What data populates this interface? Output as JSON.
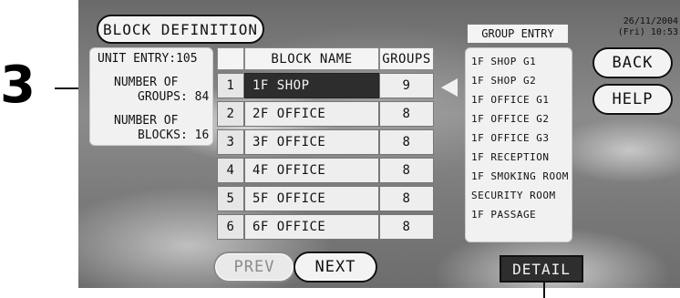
{
  "callout": {
    "label": "3"
  },
  "window": {
    "title": "BLOCK DEFINITION",
    "date": "26/11/2004",
    "day_time": "(Fri) 10:53"
  },
  "info": {
    "unit_entry": "UNIT ENTRY:105",
    "groups_line1": "NUMBER OF",
    "groups_line2": "GROUPS: 84",
    "blocks_line1": "NUMBER OF",
    "blocks_line2": "BLOCKS: 16"
  },
  "table": {
    "headers": {
      "num": "",
      "name": "BLOCK NAME",
      "groups": "GROUPS"
    },
    "rows": [
      {
        "num": "1",
        "name": "1F SHOP",
        "groups": "9"
      },
      {
        "num": "2",
        "name": "2F OFFICE",
        "groups": "8"
      },
      {
        "num": "3",
        "name": "3F OFFICE",
        "groups": "8"
      },
      {
        "num": "4",
        "name": "4F OFFICE",
        "groups": "8"
      },
      {
        "num": "5",
        "name": "5F OFFICE",
        "groups": "8"
      },
      {
        "num": "6",
        "name": "6F OFFICE",
        "groups": "8"
      }
    ]
  },
  "group_entry": {
    "title": "GROUP ENTRY",
    "items": [
      "1F SHOP G1",
      "1F SHOP G2",
      "1F OFFICE G1",
      "1F OFFICE G2",
      "1F OFFICE G3",
      "1F RECEPTION",
      "1F SMOKING ROOM",
      "SECURITY ROOM",
      "1F PASSAGE"
    ]
  },
  "buttons": {
    "back": "BACK",
    "help": "HELP",
    "prev": "PREV",
    "next": "NEXT",
    "detail": "DETAIL"
  }
}
